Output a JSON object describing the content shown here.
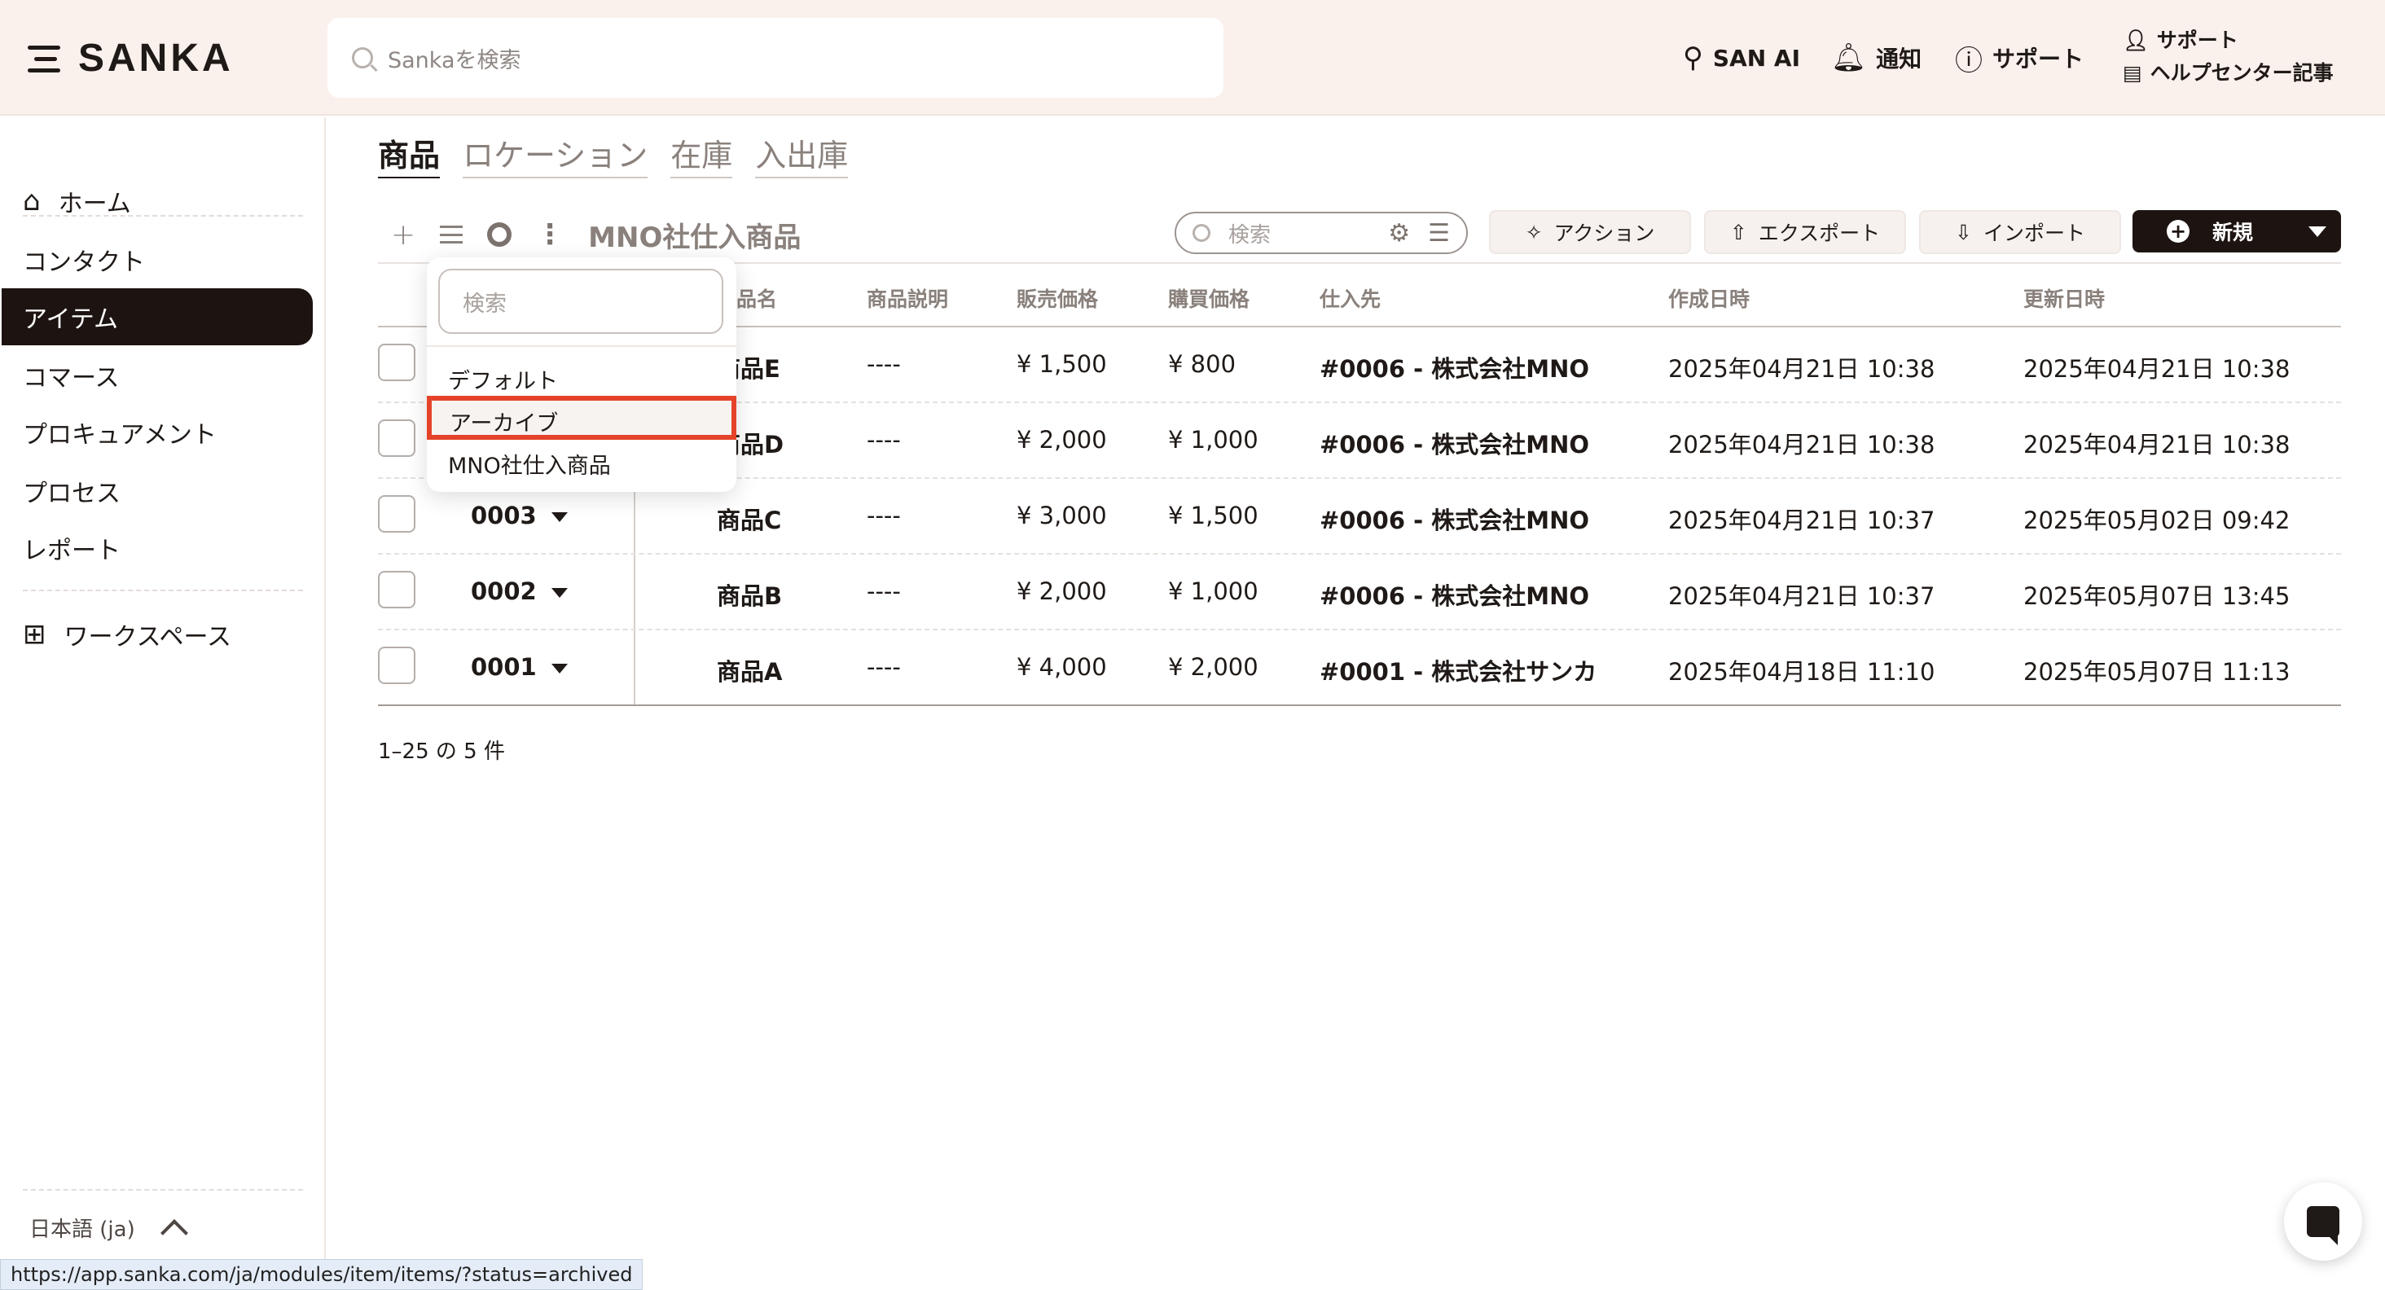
{
  "app": {
    "logo": "SANKA"
  },
  "header": {
    "search_placeholder": "Sankaを検索",
    "san_ai": "SAN AI",
    "notifications": "通知",
    "support": "サポート",
    "help_support": "サポート",
    "help_center": "ヘルプセンター記事"
  },
  "sidebar": {
    "home": "ホーム",
    "items": [
      "コンタクト",
      "アイテム",
      "コマース",
      "プロキュアメント",
      "プロセス",
      "レポート"
    ],
    "workspace": "ワークスペース",
    "language": "日本語 (ja)"
  },
  "tabs": [
    "商品",
    "ロケーション",
    "在庫",
    "入出庫"
  ],
  "toolbar": {
    "view_name": "MNO社仕入商品",
    "search_placeholder": "検索",
    "action": "アクション",
    "export": "エクスポート",
    "import": "インポート",
    "new": "新規"
  },
  "dropdown": {
    "search_placeholder": "検索",
    "items": [
      "デフォルト",
      "アーカイブ",
      "MNO社仕入商品"
    ]
  },
  "table": {
    "headers": [
      "品名",
      "商品説明",
      "販売価格",
      "購買価格",
      "仕入先",
      "作成日時",
      "更新日時"
    ],
    "rows": [
      {
        "id": "",
        "name": "商品E",
        "desc": "----",
        "price": "¥ 1,500",
        "cost": "¥ 800",
        "supplier": "#0006 - 株式会社MNO",
        "created": "2025年04月21日 10:38",
        "updated": "2025年04月21日 10:38"
      },
      {
        "id": "",
        "name": "商品D",
        "desc": "----",
        "price": "¥ 2,000",
        "cost": "¥ 1,000",
        "supplier": "#0006 - 株式会社MNO",
        "created": "2025年04月21日 10:38",
        "updated": "2025年04月21日 10:38"
      },
      {
        "id": "0003",
        "name": "商品C",
        "desc": "----",
        "price": "¥ 3,000",
        "cost": "¥ 1,500",
        "supplier": "#0006 - 株式会社MNO",
        "created": "2025年04月21日 10:37",
        "updated": "2025年05月02日 09:42"
      },
      {
        "id": "0002",
        "name": "商品B",
        "desc": "----",
        "price": "¥ 2,000",
        "cost": "¥ 1,000",
        "supplier": "#0006 - 株式会社MNO",
        "created": "2025年04月21日 10:37",
        "updated": "2025年05月07日 13:45"
      },
      {
        "id": "0001",
        "name": "商品A",
        "desc": "----",
        "price": "¥ 4,000",
        "cost": "¥ 2,000",
        "supplier": "#0001 - 株式会社サンカ",
        "created": "2025年04月18日 11:10",
        "updated": "2025年05月07日 11:13"
      }
    ]
  },
  "pagination": "1–25 の 5 件",
  "status_bar_url": "https://app.sanka.com/ja/modules/item/items/?status=archived",
  "colors": {
    "accent_dark": "#1d1411",
    "header_bg": "#fbf1ec",
    "highlight_red": "#e4432a"
  }
}
